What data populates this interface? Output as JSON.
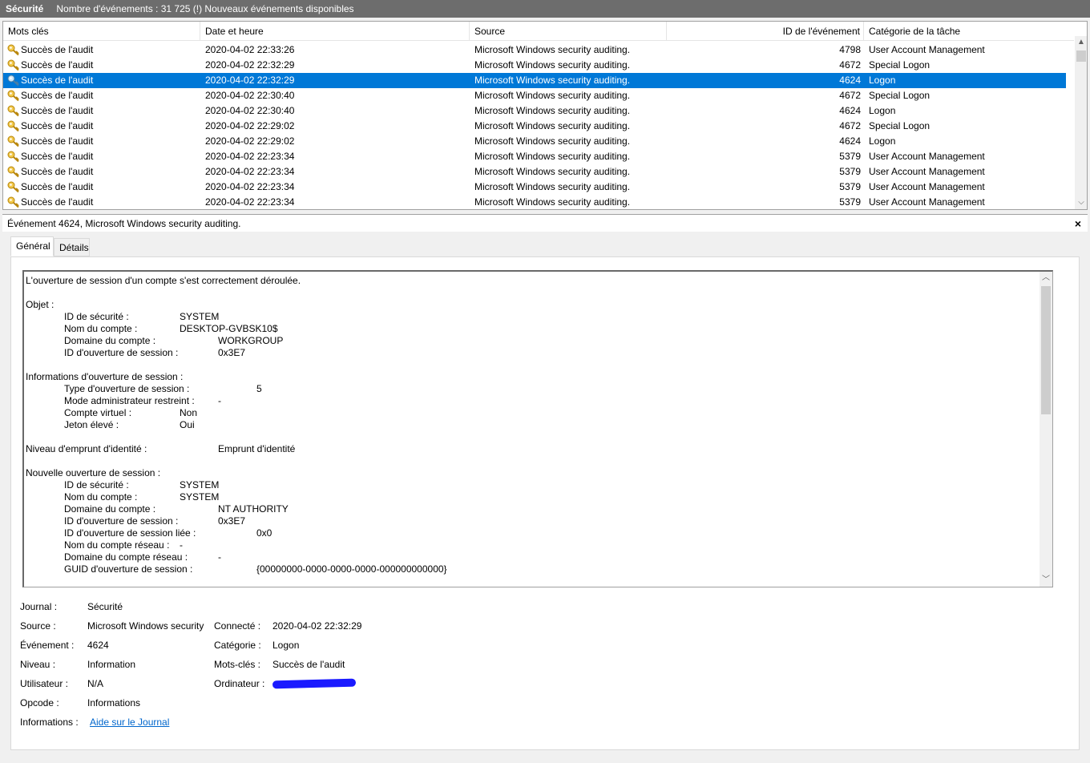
{
  "titlebar": {
    "title": "Sécurité",
    "subtitle": "Nombre d'événements : 31 725 (!) Nouveaux événements disponibles"
  },
  "list": {
    "columns": [
      "Mots clés",
      "Date et heure",
      "Source",
      "ID de l'événement",
      "Catégorie de la tâche"
    ],
    "rows": [
      {
        "keyword": "Succès de l'audit",
        "date": "2020-04-02 22:33:26",
        "source": "Microsoft Windows security auditing.",
        "id": "4798",
        "category": "User Account Management"
      },
      {
        "keyword": "Succès de l'audit",
        "date": "2020-04-02 22:32:29",
        "source": "Microsoft Windows security auditing.",
        "id": "4672",
        "category": "Special Logon"
      },
      {
        "keyword": "Succès de l'audit",
        "date": "2020-04-02 22:32:29",
        "source": "Microsoft Windows security auditing.",
        "id": "4624",
        "category": "Logon"
      },
      {
        "keyword": "Succès de l'audit",
        "date": "2020-04-02 22:30:40",
        "source": "Microsoft Windows security auditing.",
        "id": "4672",
        "category": "Special Logon"
      },
      {
        "keyword": "Succès de l'audit",
        "date": "2020-04-02 22:30:40",
        "source": "Microsoft Windows security auditing.",
        "id": "4624",
        "category": "Logon"
      },
      {
        "keyword": "Succès de l'audit",
        "date": "2020-04-02 22:29:02",
        "source": "Microsoft Windows security auditing.",
        "id": "4672",
        "category": "Special Logon"
      },
      {
        "keyword": "Succès de l'audit",
        "date": "2020-04-02 22:29:02",
        "source": "Microsoft Windows security auditing.",
        "id": "4624",
        "category": "Logon"
      },
      {
        "keyword": "Succès de l'audit",
        "date": "2020-04-02 22:23:34",
        "source": "Microsoft Windows security auditing.",
        "id": "5379",
        "category": "User Account Management"
      },
      {
        "keyword": "Succès de l'audit",
        "date": "2020-04-02 22:23:34",
        "source": "Microsoft Windows security auditing.",
        "id": "5379",
        "category": "User Account Management"
      },
      {
        "keyword": "Succès de l'audit",
        "date": "2020-04-02 22:23:34",
        "source": "Microsoft Windows security auditing.",
        "id": "5379",
        "category": "User Account Management"
      },
      {
        "keyword": "Succès de l'audit",
        "date": "2020-04-02 22:23:34",
        "source": "Microsoft Windows security auditing.",
        "id": "5379",
        "category": "User Account Management"
      }
    ]
  },
  "detail": {
    "header": "Événement 4624, Microsoft Windows security auditing.",
    "close": "×",
    "tabs": [
      "Général",
      "Détails"
    ],
    "message": {
      "intro": "L'ouverture de session d'un compte s'est correctement déroulée.",
      "objet_title": "Objet :",
      "objet": [
        {
          "label": "ID de sécurité :",
          "value": "SYSTEM"
        },
        {
          "label": "Nom du compte :",
          "value": "DESKTOP-GVBSK10$"
        },
        {
          "label": "Domaine du compte :",
          "value": "WORKGROUP"
        },
        {
          "label": "ID d'ouverture de session :",
          "value": "0x3E7"
        }
      ],
      "info_title": "Informations d'ouverture de session :",
      "info": [
        {
          "label": "Type d'ouverture de session :",
          "value": "5"
        },
        {
          "label": "Mode administrateur restreint :",
          "value": "-"
        },
        {
          "label": "Compte virtuel :",
          "value": "Non"
        },
        {
          "label": "Jeton élevé :",
          "value": "Oui"
        }
      ],
      "emprunt_label": "Niveau d'emprunt d'identité :",
      "emprunt_value": "Emprunt d'identité",
      "nouvelle_title": "Nouvelle ouverture de session :",
      "nouvelle": [
        {
          "label": "ID de sécurité :",
          "value": "SYSTEM"
        },
        {
          "label": "Nom du compte :",
          "value": "SYSTEM"
        },
        {
          "label": "Domaine du compte :",
          "value": "NT AUTHORITY"
        },
        {
          "label": "ID d'ouverture de session :",
          "value": "0x3E7"
        },
        {
          "label": "ID d'ouverture de session liée :",
          "value": "0x0"
        },
        {
          "label": "Nom du compte réseau :",
          "value": "-"
        },
        {
          "label": "Domaine du compte réseau :",
          "value": "-"
        },
        {
          "label": "GUID d'ouverture de session :",
          "value": "{00000000-0000-0000-0000-000000000000}"
        }
      ]
    },
    "props": {
      "journal_label": "Journal :",
      "journal": "Sécurité",
      "source_label": "Source :",
      "source": "Microsoft Windows security",
      "connecte_label": "Connecté :",
      "connecte": "2020-04-02 22:32:29",
      "evenement_label": "Événement :",
      "evenement": "4624",
      "categorie_label": "Catégorie :",
      "categorie": "Logon",
      "niveau_label": "Niveau :",
      "niveau": "Information",
      "motscles_label": "Mots-clés :",
      "motscles": "Succès de l'audit",
      "utilisateur_label": "Utilisateur :",
      "utilisateur": "N/A",
      "ordinateur_label": "Ordinateur :",
      "opcode_label": "Opcode :",
      "opcode": "Informations",
      "informations_label": "Informations :",
      "informations_link": "Aide sur le Journal"
    }
  }
}
